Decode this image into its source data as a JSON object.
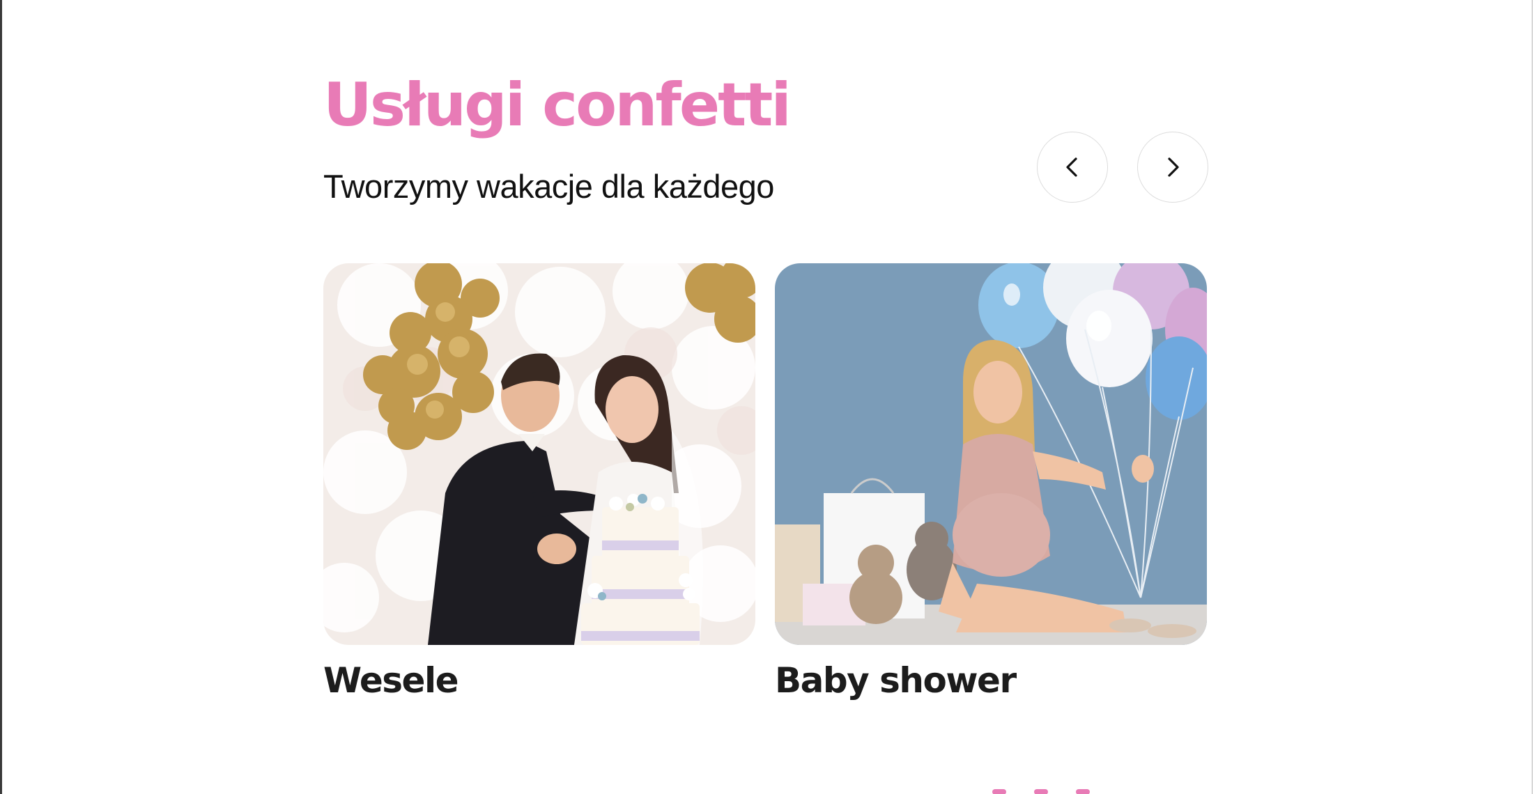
{
  "section": {
    "title": "Usługi confetti",
    "subtitle": "Tworzymy wakacje dla każdego",
    "accent_color": "#e87bb6"
  },
  "carousel": {
    "prev_icon": "chevron-left-icon",
    "next_icon": "chevron-right-icon"
  },
  "cards": [
    {
      "label": "Wesele",
      "image": "wedding-couple-cutting-cake-photo"
    },
    {
      "label": "Baby shower",
      "image": "pregnant-woman-with-balloons-photo"
    }
  ]
}
